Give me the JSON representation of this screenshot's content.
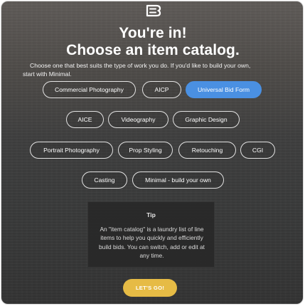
{
  "header": {
    "logo_icon": "brand-logo-icon",
    "title_line1": "You're in!",
    "title_line2": "Choose an item catalog.",
    "subtitle_line1": "Choose one that best suits the type of work you do. If you'd like to build your own,",
    "subtitle_line2": "start with Minimal."
  },
  "catalogs": {
    "selected": "Universal Bid Form",
    "options": [
      {
        "label": "Commercial Photography"
      },
      {
        "label": "AICP"
      },
      {
        "label": "Universal Bid Form"
      },
      {
        "label": "AICE"
      },
      {
        "label": "Videography"
      },
      {
        "label": "Graphic Design"
      },
      {
        "label": "Portrait Photography"
      },
      {
        "label": "Prop Styling"
      },
      {
        "label": "Retouching"
      },
      {
        "label": "CGI"
      },
      {
        "label": "Casting"
      },
      {
        "label": "Minimal - build your own"
      }
    ]
  },
  "tip": {
    "title": "Tip",
    "body": "An \"item catalog\" is a laundry list of line items to help you quickly and efficiently build bids. You can switch, add or edit at any time."
  },
  "cta": {
    "label": "LET'S GO!"
  },
  "colors": {
    "selected_chip": "#4a90e2",
    "cta": "#e6bb45"
  }
}
